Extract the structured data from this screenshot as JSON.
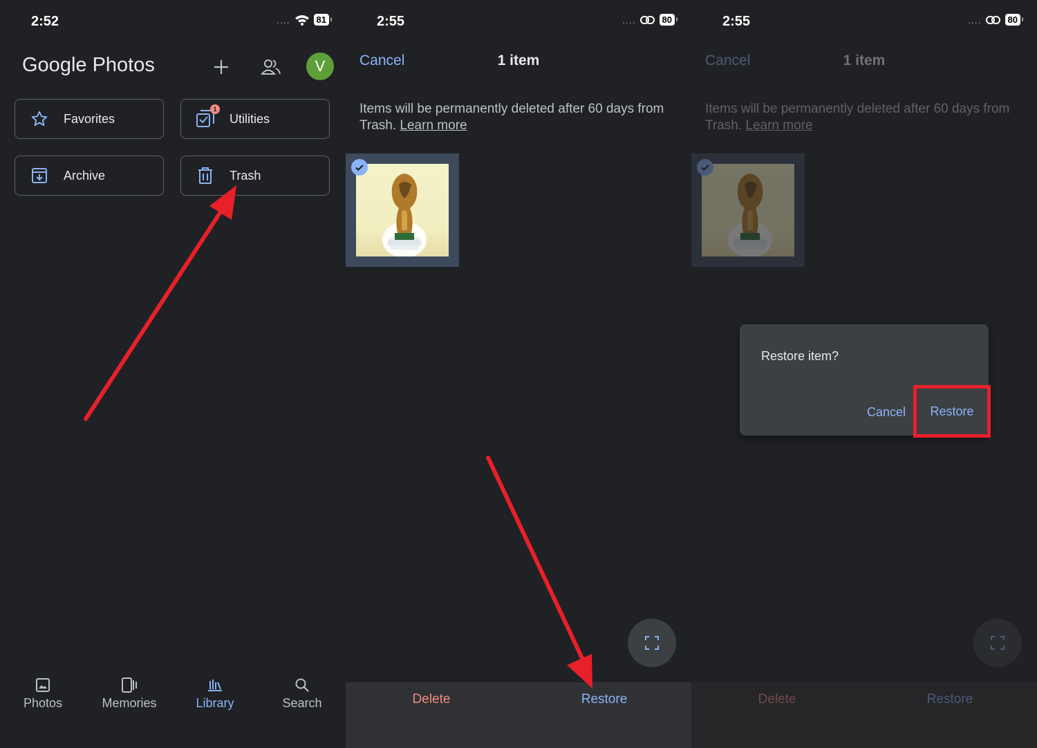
{
  "panel1": {
    "status": {
      "time": "2:52",
      "battery": "81"
    },
    "app_title": "Google Photos",
    "avatar_letter": "V",
    "library_buttons": [
      {
        "label": "Favorites",
        "icon": "star-icon"
      },
      {
        "label": "Utilities",
        "icon": "utilities-icon",
        "badge": "1"
      },
      {
        "label": "Archive",
        "icon": "archive-icon"
      },
      {
        "label": "Trash",
        "icon": "trash-icon"
      }
    ],
    "nav": [
      {
        "label": "Photos",
        "icon": "photo-icon"
      },
      {
        "label": "Memories",
        "icon": "memories-icon"
      },
      {
        "label": "Library",
        "icon": "library-icon",
        "active": true
      },
      {
        "label": "Search",
        "icon": "search-icon"
      }
    ]
  },
  "panel2": {
    "status": {
      "time": "2:55",
      "battery": "80"
    },
    "cancel": "Cancel",
    "item_count": "1 item",
    "note": "Items will be permanently deleted after 60 days from Trash.",
    "learn_more": "Learn more",
    "actions": {
      "delete": "Delete",
      "restore": "Restore"
    }
  },
  "panel3": {
    "status": {
      "time": "2:55",
      "battery": "80"
    },
    "cancel": "Cancel",
    "item_count": "1 item",
    "note": "Items will be permanently deleted after 60 days from Trash.",
    "learn_more": "Learn more",
    "actions": {
      "delete": "Delete",
      "restore": "Restore"
    },
    "dialog": {
      "title": "Restore item?",
      "cancel": "Cancel",
      "restore": "Restore"
    }
  },
  "colors": {
    "background": "#202124",
    "accent": "#8ab4f8",
    "delete": "#f28b82",
    "annotation_red": "#e8202a"
  }
}
